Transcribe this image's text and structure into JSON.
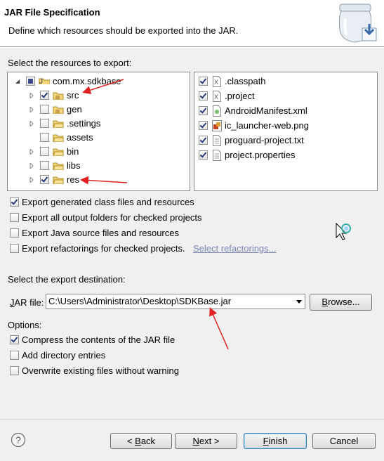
{
  "header": {
    "title": "JAR File Specification",
    "subtitle": "Define which resources should be exported into the JAR."
  },
  "resources": {
    "label": "Select the resources to export:",
    "tree": [
      {
        "label": "com.mx.sdkbase",
        "state": "partial"
      },
      {
        "label": "src",
        "state": "checked"
      },
      {
        "label": "gen",
        "state": "unchecked"
      },
      {
        "label": ".settings",
        "state": "unchecked"
      },
      {
        "label": "assets",
        "state": "unchecked"
      },
      {
        "label": "bin",
        "state": "unchecked"
      },
      {
        "label": "libs",
        "state": "unchecked"
      },
      {
        "label": "res",
        "state": "checked"
      }
    ],
    "files": [
      {
        "label": ".classpath",
        "state": "checked"
      },
      {
        "label": ".project",
        "state": "checked"
      },
      {
        "label": "AndroidManifest.xml",
        "state": "checked"
      },
      {
        "label": "ic_launcher-web.png",
        "state": "checked"
      },
      {
        "label": "proguard-project.txt",
        "state": "checked"
      },
      {
        "label": "project.properties",
        "state": "checked"
      }
    ]
  },
  "export_options": [
    {
      "label": "Export generated class files and resources",
      "checked": true
    },
    {
      "label": "Export all output folders for checked projects",
      "checked": false
    },
    {
      "label": "Export Java source files and resources",
      "checked": false
    },
    {
      "label": "Export refactorings for checked projects.",
      "checked": false
    }
  ],
  "select_refactorings_link": "Select refactorings...",
  "destination": {
    "label": "Select the export destination:",
    "jar_label": "JAR file:",
    "jar_value": "C:\\Users\\Administrator\\Desktop\\SDKBase.jar",
    "browse_label": "Browse..."
  },
  "options": {
    "label": "Options:",
    "items": [
      {
        "label": "Compress the contents of the JAR file",
        "checked": true
      },
      {
        "label": "Add directory entries",
        "checked": false
      },
      {
        "label": "Overwrite existing files without warning",
        "checked": false
      }
    ]
  },
  "footer": {
    "help": "?",
    "back": "< Back",
    "next": "Next >",
    "finish": "Finish",
    "cancel": "Cancel"
  }
}
